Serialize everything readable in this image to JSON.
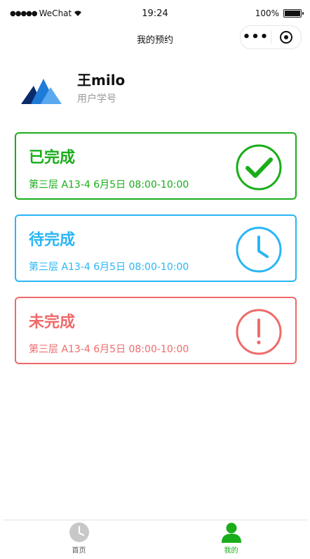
{
  "status_bar": {
    "signal": "●●●●●",
    "carrier": "WeChat",
    "time": "19:24",
    "battery_percent": "100%",
    "battery_level": 1.0
  },
  "nav": {
    "title": "我的预约"
  },
  "profile": {
    "name": "王milo",
    "student_id": "用户学号"
  },
  "reservations": [
    {
      "status": "已完成",
      "detail": "第三层 A13-4 6月5日 08:00-10:00",
      "color": "#1aad19",
      "icon": "check-circle-icon"
    },
    {
      "status": "待完成",
      "detail": "第三层 A13-4 6月5日 08:00-10:00",
      "color": "#29b6f6",
      "icon": "clock-icon"
    },
    {
      "status": "未完成",
      "detail": "第三层 A13-4 6月5日 08:00-10:00",
      "color": "#ef6a6a",
      "icon": "exclamation-circle-icon"
    }
  ],
  "tabbar": {
    "items": [
      {
        "label": "首页",
        "active": false,
        "icon": "clock-icon"
      },
      {
        "label": "我的",
        "active": true,
        "icon": "user-icon"
      }
    ],
    "active_color": "#1aad19",
    "inactive_color": "#999999"
  }
}
